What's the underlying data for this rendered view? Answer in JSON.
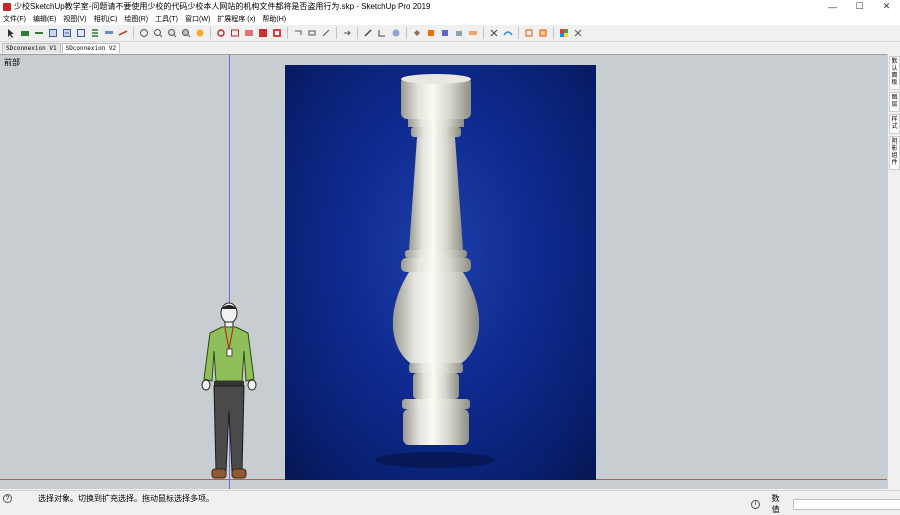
{
  "window": {
    "title": "少校SketchUp教学室-问题请不要使用少校的代码少校本人网站的机构文件都将是否盗用行为.skp - SketchUp Pro 2019",
    "minimize": "—",
    "maximize": "☐",
    "close": "✕"
  },
  "menu": [
    "文件(F)",
    "编辑(E)",
    "视图(V)",
    "相机(C)",
    "绘图(R)",
    "工具(T)",
    "窗口(W)",
    "扩展程序 (x)",
    "帮助(H)"
  ],
  "scenes": {
    "tabs": [
      "SDconnexion V1",
      "SDconnexion V2"
    ]
  },
  "viewport": {
    "label": "前部",
    "background": "#c7cdd1",
    "photo_bg": "#0e2a8f"
  },
  "right_panel": {
    "tabs": [
      "默认面板",
      "图层",
      "样式",
      "阴影组件"
    ]
  },
  "status": {
    "help_icon": "?",
    "text": "选择对象。切换到扩充选择。拖动鼠标选择多项。",
    "info_icon": "i",
    "measure_label": "数值",
    "measure_value": ""
  },
  "icons": {
    "toolbar": [
      "select-icon",
      "eraser-icon",
      "line-icon",
      "rectangle-icon",
      "push-pull-icon",
      "rotate-icon",
      "scale-icon",
      "offset-icon",
      "tape-icon",
      "orbit-icon",
      "pan-icon",
      "zoom-icon",
      "zoom-extents-icon",
      "paint-icon",
      "component-icon",
      "group-icon",
      "warehouse-icon",
      "extension-warehouse-icon",
      "layout-icon",
      "section-icon",
      "follow-me-icon",
      "sandbox-icon",
      "material-icon"
    ]
  }
}
